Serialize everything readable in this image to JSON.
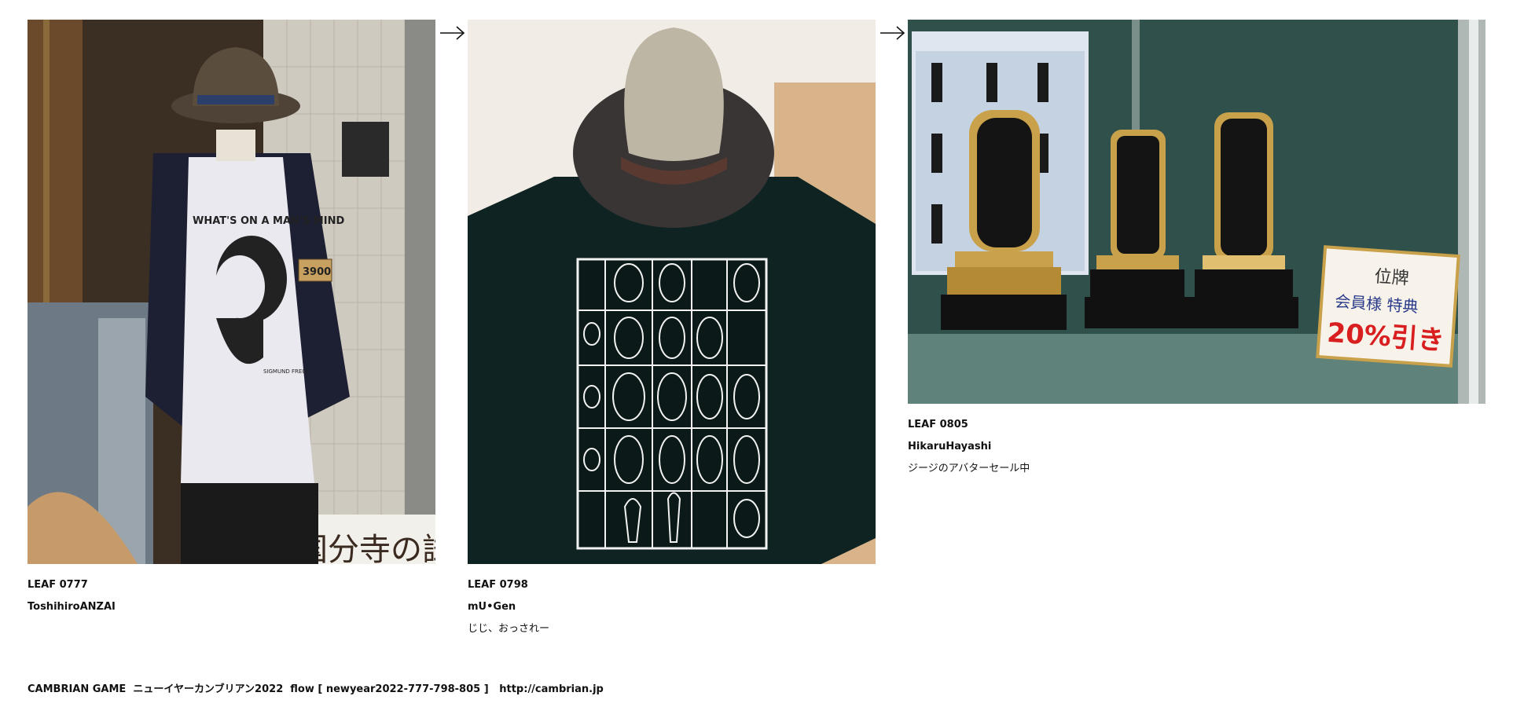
{
  "leaves": [
    {
      "code": "LEAF 0777",
      "author": "ToshihiroANZAI",
      "caption": "",
      "photo": {
        "shirt_text": "WHAT'S ON A MAN'S MIND",
        "shirt_signature": "SIGMUND FREUD",
        "price_tag": "3900",
        "sign_text": "国分寺の試"
      }
    },
    {
      "code": "LEAF 0798",
      "author": "mU•Gen",
      "caption": "じじ、おっされー",
      "photo": {}
    },
    {
      "code": "LEAF 0805",
      "author": "HikaruHayashi",
      "caption": "ジージのアバターセール中",
      "photo": {
        "card_title": "位牌",
        "card_subtitle": "会員様 特典",
        "card_discount": "20%引き"
      }
    }
  ],
  "footer": {
    "text": "CAMBRIAN GAME  ニューイヤーカンブリアン2022  flow [ newyear2022-777-798-805 ]",
    "link": "http://cambrian.jp"
  }
}
